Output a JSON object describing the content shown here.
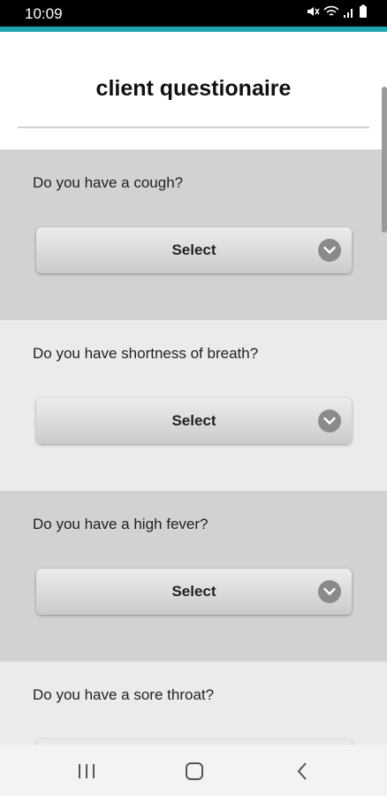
{
  "status": {
    "time": "10:09"
  },
  "page": {
    "title": "client questionaire"
  },
  "questions": [
    {
      "text": "Do you have a cough?",
      "select": "Select"
    },
    {
      "text": "Do you have shortness of breath?",
      "select": "Select"
    },
    {
      "text": "Do you have a high fever?",
      "select": "Select"
    },
    {
      "text": "Do you have a sore throat?",
      "select": ""
    }
  ],
  "icons": {
    "status": [
      "mute-icon",
      "wifi-icon",
      "signal-icon",
      "battery-icon"
    ],
    "dropdown": "chevron-down-icon",
    "nav": [
      "recent-apps-icon",
      "home-icon",
      "back-icon"
    ]
  },
  "colors": {
    "accent": "#1fa3ae",
    "section_dark": "#d2d2d2",
    "section_light": "#ebebeb"
  }
}
